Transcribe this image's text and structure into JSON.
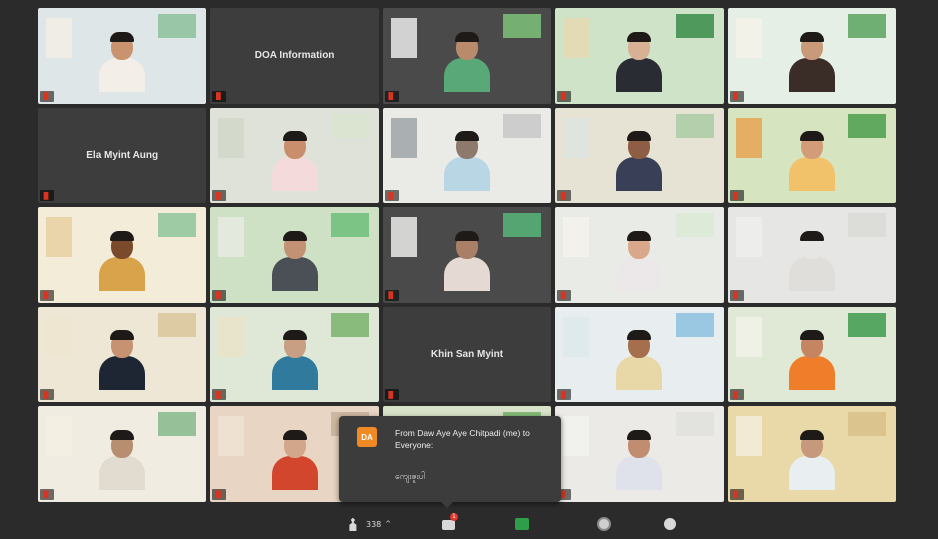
{
  "tiles": [
    {
      "type": "video",
      "name": "",
      "bg": "#dfe6e8",
      "shirt": "#f3efe8",
      "skin": "#c9936f",
      "d1": "#8cc09a",
      "d2": "#f2efe4"
    },
    {
      "type": "label",
      "name": "DOA Information"
    },
    {
      "type": "video",
      "name": "",
      "bg": "#4a4a4a",
      "shirt": "#59a978",
      "skin": "#b98a6c",
      "d1": "#7dc279",
      "d2": "#f4f4f4"
    },
    {
      "type": "video",
      "name": "",
      "bg": "#cfe3c8",
      "shirt": "#2a2c34",
      "skin": "#d8b093",
      "d1": "#3a8c4a",
      "d2": "#e7d8b0"
    },
    {
      "type": "video",
      "name": "",
      "bg": "#e6efe6",
      "shirt": "#3a2d28",
      "skin": "#c99a7a",
      "d1": "#5aa35f",
      "d2": "#f6f3ea"
    },
    {
      "type": "label",
      "name": "Ela Myint Aung"
    },
    {
      "type": "video",
      "name": "",
      "bg": "#dfe2d8",
      "shirt": "#f4dada",
      "skin": "#c98f6d",
      "d1": "#d9e4cf",
      "d2": "#d0d8c8"
    },
    {
      "type": "video",
      "name": "",
      "bg": "#eaeae6",
      "shirt": "#b9d6e4",
      "skin": "#8e7a6c",
      "d1": "#c8c8c8",
      "d2": "#9aa0a4"
    },
    {
      "type": "video",
      "name": "",
      "bg": "#e7e3d4",
      "shirt": "#3a3f58",
      "skin": "#8e5e44",
      "d1": "#a9cba5",
      "d2": "#dde5e0"
    },
    {
      "type": "video",
      "name": "",
      "bg": "#d7e4c0",
      "shirt": "#f2c26a",
      "skin": "#d29c78",
      "d1": "#4b9f4e",
      "d2": "#e9a04d"
    },
    {
      "type": "video",
      "name": "",
      "bg": "#f3ecd9",
      "shirt": "#d9a34b",
      "skin": "#7a4a2a",
      "d1": "#8fc59a",
      "d2": "#e6cf9c"
    },
    {
      "type": "video",
      "name": "",
      "bg": "#cfe1c4",
      "shirt": "#4b4f56",
      "skin": "#c39173",
      "d1": "#6dbd7b",
      "d2": "#e9ebe3"
    },
    {
      "type": "video",
      "name": "",
      "bg": "#4a4a4a",
      "shirt": "#e5dad3",
      "skin": "#a97f68",
      "d1": "#57b57a",
      "d2": "#f5f5f3"
    },
    {
      "type": "video",
      "name": "",
      "bg": "#e9ece6",
      "shirt": "#ece8ea",
      "skin": "#d9a88a",
      "d1": "#d9ead4",
      "d2": "#f4f2ee"
    },
    {
      "type": "video",
      "name": "",
      "bg": "#e6e6e4",
      "shirt": "#e0dedb",
      "skin": "#e6e6e4",
      "d1": "#d9d9d6",
      "d2": "#efefec"
    },
    {
      "type": "video",
      "name": "",
      "bg": "#eee7d6",
      "shirt": "#1f2633",
      "skin": "#c69272",
      "d1": "#d9c59a",
      "d2": "#efe6cf"
    },
    {
      "type": "video",
      "name": "",
      "bg": "#dfe8d6",
      "shirt": "#2f7a9d",
      "skin": "#c99f84",
      "d1": "#7ab36c",
      "d2": "#e9e2c8"
    },
    {
      "type": "label",
      "name": "Khin San Myint"
    },
    {
      "type": "video",
      "name": "",
      "bg": "#e8eef0",
      "shirt": "#e8d8a8",
      "skin": "#a56e4c",
      "d1": "#8cc0df",
      "d2": "#dce8eb"
    },
    {
      "type": "video",
      "name": "",
      "bg": "#dfe9d6",
      "shirt": "#f07d2a",
      "skin": "#c58560",
      "d1": "#3f9b4d",
      "d2": "#f3f1ea"
    },
    {
      "type": "video",
      "name": "",
      "bg": "#f1ece2",
      "shirt": "#e2dcd0",
      "skin": "#b88e70",
      "d1": "#86b98a",
      "d2": "#f5f0e4"
    },
    {
      "type": "video",
      "name": "",
      "bg": "#e8d5c3",
      "shirt": "#d1462c",
      "skin": "#d2a68a",
      "d1": "#c8b29a",
      "d2": "#efe4d5"
    },
    {
      "type": "video",
      "name": "",
      "bg": "#d8e2c8",
      "shirt": "#5a7ea8",
      "skin": "#c39b7a",
      "d1": "#76b46a",
      "d2": "#ece8d8"
    },
    {
      "type": "video",
      "name": "",
      "bg": "#eceae6",
      "shirt": "#dfe2ea",
      "skin": "#c08d70",
      "d1": "#e0e0dc",
      "d2": "#f3f3f0"
    },
    {
      "type": "video",
      "name": "",
      "bg": "#e9d8a8",
      "shirt": "#e9eef0",
      "skin": "#c6987c",
      "d1": "#d8c18a",
      "d2": "#f4efe0"
    }
  ],
  "chat": {
    "avatar_initials": "DA",
    "from_line": "From Daw Aye Aye Chitpadi (me) to Everyone:",
    "message": "ကျေးဇူးပါ"
  },
  "toolbar": {
    "participants_count": "338",
    "participants_caret": "^",
    "chat_badge": "1"
  },
  "status": {
    "left_indicator": "f"
  },
  "colors": {
    "mute_icon": "#d9341f",
    "share_button": "#2e9e4a",
    "chat_avatar": "#f08a24"
  }
}
